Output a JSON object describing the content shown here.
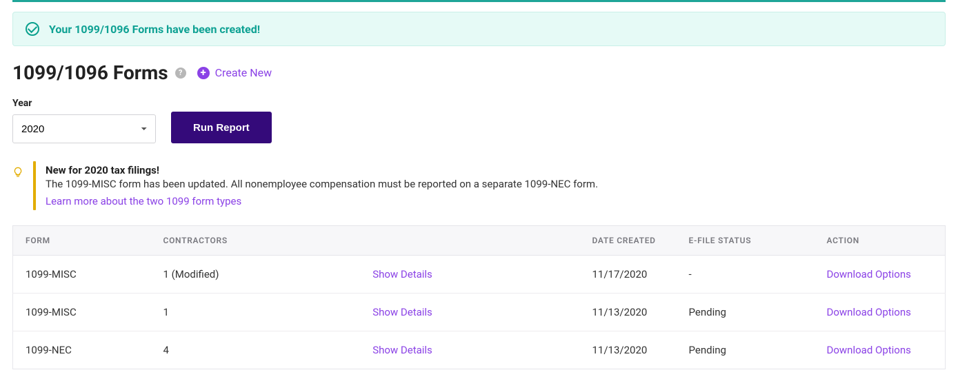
{
  "alert": {
    "message": "Your 1099/1096 Forms have been created!"
  },
  "header": {
    "title": "1099/1096 Forms",
    "create_label": "Create New"
  },
  "controls": {
    "year_label": "Year",
    "year_value": "2020",
    "run_label": "Run Report"
  },
  "callout": {
    "title": "New for 2020 tax filings!",
    "body": "The 1099-MISC form has been updated. All nonemployee compensation must be reported on a separate 1099-NEC form.",
    "link": "Learn more about the two 1099 form types"
  },
  "table": {
    "headers": {
      "form": "Form",
      "contractors": "Contractors",
      "date": "Date Created",
      "status": "E-File Status",
      "action": "Action"
    },
    "details_label": "Show Details",
    "download_label": "Download Options",
    "rows": [
      {
        "form": "1099-MISC",
        "contractors": "1 (Modified)",
        "date": "11/17/2020",
        "status": "-"
      },
      {
        "form": "1099-MISC",
        "contractors": "1",
        "date": "11/13/2020",
        "status": "Pending"
      },
      {
        "form": "1099-NEC",
        "contractors": "4",
        "date": "11/13/2020",
        "status": "Pending"
      }
    ]
  }
}
